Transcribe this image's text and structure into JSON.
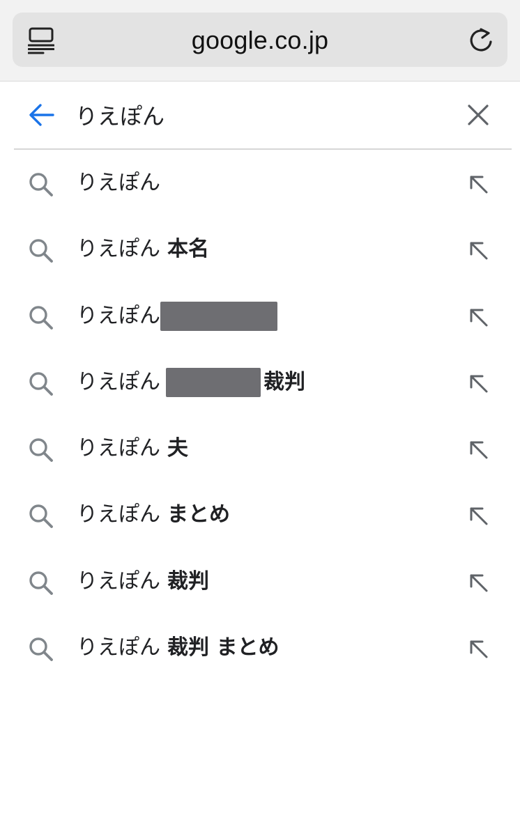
{
  "browser": {
    "url": "google.co.jp",
    "reader_icon": "reader-view-icon",
    "reload_icon": "reload-icon"
  },
  "search": {
    "query": "りえぽん",
    "back_icon": "back-arrow-icon",
    "clear_icon": "close-icon",
    "accent_color": "#1a73e8"
  },
  "suggestions": [
    {
      "prefix": "りえぽん",
      "suffix": ""
    },
    {
      "prefix": "りえぽん",
      "suffix": "本名"
    },
    {
      "prefix": "りえぽん",
      "suffix": "",
      "redacted": true
    },
    {
      "prefix": "りえぽん",
      "suffix": "裁判",
      "redacted": true
    },
    {
      "prefix": "りえぽん",
      "suffix": "夫"
    },
    {
      "prefix": "りえぽん",
      "suffix": "まとめ"
    },
    {
      "prefix": "りえぽん",
      "suffix": "裁判"
    },
    {
      "prefix": "りえぽん",
      "suffix": "裁判 まとめ"
    }
  ],
  "icons": {
    "suggestion_icon": "search-icon",
    "fill_icon": "arrow-up-left-icon",
    "icon_color": "#80868b"
  }
}
